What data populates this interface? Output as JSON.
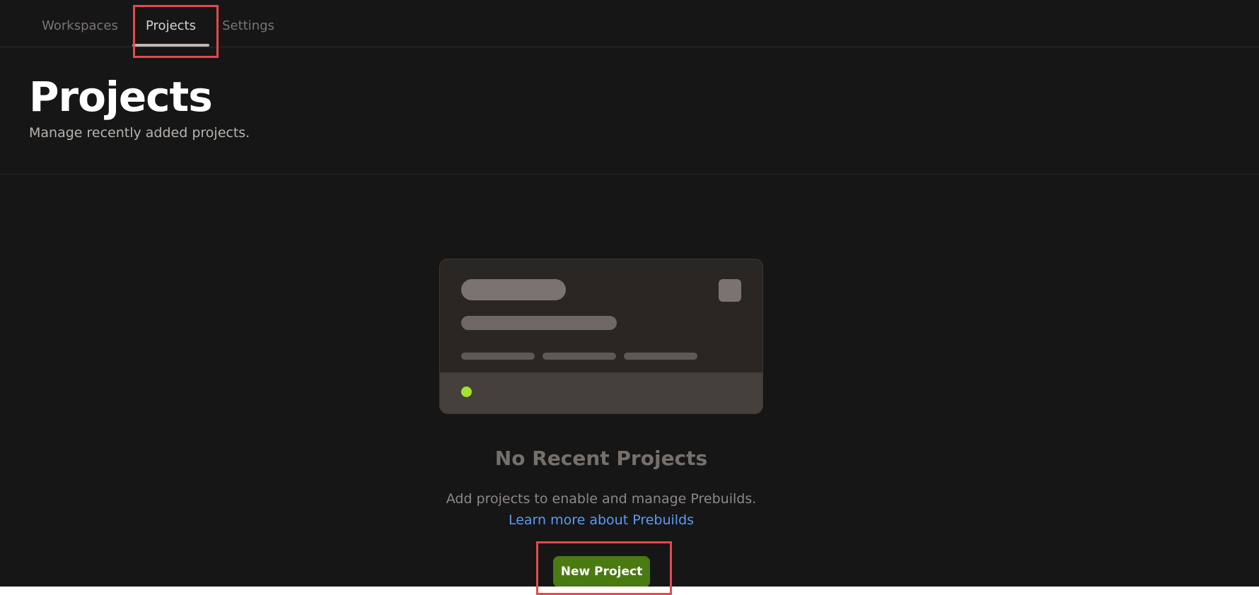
{
  "nav": {
    "tabs": [
      {
        "label": "Workspaces",
        "active": false
      },
      {
        "label": "Projects",
        "active": true
      },
      {
        "label": "Settings",
        "active": false
      }
    ]
  },
  "header": {
    "title": "Projects",
    "subtitle": "Manage recently added projects."
  },
  "empty_state": {
    "title": "No Recent Projects",
    "description": "Add projects to enable and manage Prebuilds.",
    "link_label": "Learn more about Prebuilds",
    "button_label": "New Project"
  },
  "colors": {
    "background": "#161616",
    "accent_button": "#4a7a12",
    "link": "#5b9bf5",
    "status_dot": "#a4e22f",
    "annotation": "#e5484d"
  }
}
